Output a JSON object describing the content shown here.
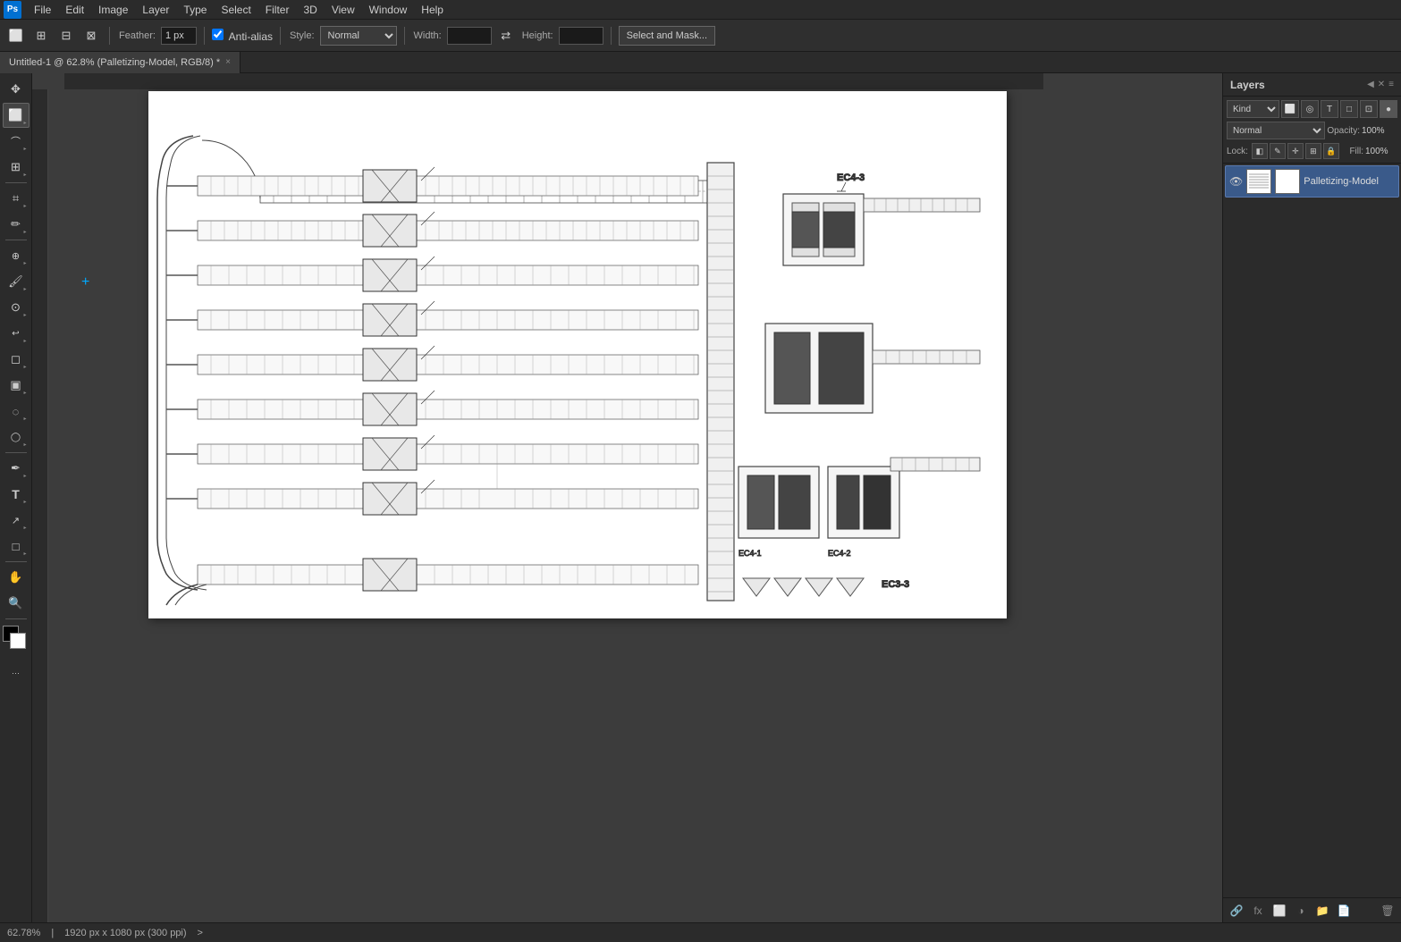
{
  "app": {
    "title": "Adobe Photoshop",
    "icon_label": "Ps"
  },
  "menu": {
    "items": [
      "File",
      "Edit",
      "Image",
      "Layer",
      "Type",
      "Select",
      "Filter",
      "3D",
      "View",
      "Window",
      "Help"
    ]
  },
  "toolbar": {
    "feather_label": "Feather:",
    "feather_value": "1 px",
    "anti_alias_label": "Anti-alias",
    "style_label": "Style:",
    "style_value": "Normal",
    "width_label": "Width:",
    "width_value": "",
    "height_label": "Height:",
    "height_value": "",
    "select_mask_btn": "Select and Mask..."
  },
  "tab": {
    "title": "Untitled-1 @ 62.8% (Palletizing-Model, RGB/8) *",
    "close": "×"
  },
  "layers_panel": {
    "title": "Layers",
    "filter_label": "Kind",
    "blend_mode": "Normal",
    "opacity_label": "Opacity:",
    "opacity_value": "100%",
    "lock_label": "Lock:",
    "fill_label": "Fill:",
    "fill_value": "100%",
    "layer_name": "Palletizing-Model"
  },
  "status_bar": {
    "zoom": "62.78%",
    "dimensions": "1920 px x 1080 px (300 ppi)",
    "arrow": ">"
  },
  "tools": {
    "items": [
      {
        "name": "move-tool",
        "icon": "✥",
        "has_more": false
      },
      {
        "name": "rectangle-select-tool",
        "icon": "⬜",
        "has_more": true,
        "active": true
      },
      {
        "name": "lasso-tool",
        "icon": "⌒",
        "has_more": true
      },
      {
        "name": "object-select-tool",
        "icon": "⊞",
        "has_more": true
      },
      {
        "name": "crop-tool",
        "icon": "⌗",
        "has_more": true
      },
      {
        "name": "eyedropper-tool",
        "icon": "✏",
        "has_more": true
      },
      {
        "name": "healing-tool",
        "icon": "⊕",
        "has_more": true
      },
      {
        "name": "brush-tool",
        "icon": "🖌",
        "has_more": true
      },
      {
        "name": "clone-tool",
        "icon": "⊙",
        "has_more": true
      },
      {
        "name": "history-tool",
        "icon": "⌛",
        "has_more": true
      },
      {
        "name": "eraser-tool",
        "icon": "◻",
        "has_more": true
      },
      {
        "name": "gradient-tool",
        "icon": "▣",
        "has_more": true
      },
      {
        "name": "blur-tool",
        "icon": "◌",
        "has_more": true
      },
      {
        "name": "dodge-tool",
        "icon": "◯",
        "has_more": true
      },
      {
        "name": "pen-tool",
        "icon": "✒",
        "has_more": true
      },
      {
        "name": "type-tool",
        "icon": "T",
        "has_more": true
      },
      {
        "name": "path-select-tool",
        "icon": "↗",
        "has_more": true
      },
      {
        "name": "shape-tool",
        "icon": "□",
        "has_more": true
      },
      {
        "name": "hand-tool",
        "icon": "✋",
        "has_more": false
      },
      {
        "name": "zoom-tool",
        "icon": "🔍",
        "has_more": false
      },
      {
        "name": "extra-tools",
        "icon": "···",
        "has_more": false
      }
    ]
  }
}
